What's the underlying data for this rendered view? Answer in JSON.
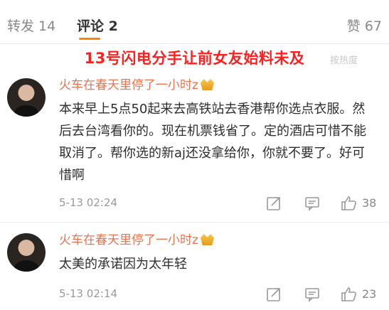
{
  "tabs": {
    "repost": "转发 14",
    "comment": "评论 2",
    "like": "赞 67"
  },
  "overlay": {
    "caption": "13号闪电分手让前女友始料未及",
    "ghost_text": "按热度"
  },
  "comments": [
    {
      "username": "火车在春天里停了一小时z",
      "text": "本来早上5点50起来去高铁站去香港帮你选点衣服。然后去台湾看你的。现在机票钱省了。定的酒店可惜不能取消了。帮你选的新aj还没拿给你，你就不要了。好可惜啊",
      "time": "5-13 02:24",
      "likes": "38"
    },
    {
      "username": "火车在春天里停了一小时z",
      "text": "太美的承诺因为太年轻",
      "time": "5-13 02:14",
      "likes": "23"
    }
  ]
}
